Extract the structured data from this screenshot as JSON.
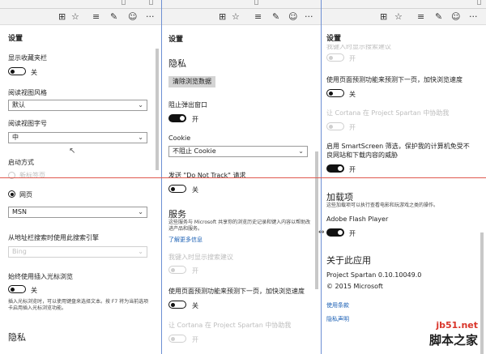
{
  "colors": {
    "accent_line": "#6d8fd3",
    "red_line": "#e05a4f",
    "link": "#1a5fb4",
    "toggle_on": "#111111"
  },
  "icons": [
    "reading-view-icon",
    "favorites-star-icon",
    "hub-icon",
    "web-note-icon",
    "smiley-feedback-icon",
    "more-icon"
  ],
  "panel1": {
    "header": "设置",
    "show_favorites_bar": {
      "label": "显示收藏夹栏",
      "state": "关"
    },
    "reading_style": {
      "label": "阅读视图风格",
      "value": "默认"
    },
    "reading_font": {
      "label": "阅读视图字号",
      "value": "中"
    },
    "startup": {
      "label": "启动方式",
      "option_disabled": "新标签页",
      "option_selected": "网页",
      "selected_value": "MSN"
    },
    "search_engine": {
      "label": "从地址栏搜索时使用此搜索引擎",
      "value": "Bing"
    },
    "caret_browsing": {
      "label": "始终使用插入光标浏览",
      "state": "关",
      "desc": "插入光标浏览时，可以使用键盘来选择文本。按 F7 将为当前选项卡启用插入光标浏览功能。"
    },
    "privacy_heading": "隐私"
  },
  "panel2": {
    "header": "设置",
    "privacy_heading": "隐私",
    "clear_button": "清除浏览数据",
    "block_popups": {
      "label": "阻止弹出窗口",
      "state": "开"
    },
    "cookie": {
      "label": "Cookie",
      "value": "不阻止 Cookie"
    },
    "dnt": {
      "label": "发送 \"Do Not Track\" 请求",
      "state": "关"
    },
    "services_heading": "服务",
    "services_desc": "这些服务与 Microsoft 共享你的浏览历史记录和键入内容以帮助改进产品和服务。",
    "learn_more": "了解更多信息",
    "search_suggestions": {
      "label": "我键入时显示搜索建议",
      "state": "开"
    },
    "page_prediction": {
      "label": "使用页面预测功能来预测下一页，加快浏览速度",
      "state": "关"
    },
    "cortana": {
      "label": "让 Cortana 在 Project Spartan 中协助我",
      "state": "开"
    }
  },
  "panel3": {
    "header": "设置",
    "top_cut_label": "我键入时显示搜索建议",
    "top_state": "开",
    "page_prediction": {
      "label": "使用页面预测功能来预测下一页，加快浏览速度",
      "state": "关"
    },
    "cortana": {
      "label": "让 Cortana 在 Project Spartan 中协助我",
      "state": "开"
    },
    "smartscreen": {
      "label": "启用 SmartScreen 筛选，保护我的计算机免受不良网站和下载内容的威胁",
      "state": "开"
    },
    "addons_heading": "加载项",
    "addons_desc": "这些加载项可以执行查看电影和玩游戏之类的操作。",
    "flash": {
      "label": "Adobe Flash Player",
      "state": "开"
    },
    "about_heading": "关于此应用",
    "app_name": "Project Spartan 0.10.10049.0",
    "copyright": "© 2015 Microsoft",
    "terms": "使用条款",
    "privacy": "隐私声明"
  },
  "watermark": {
    "site": "jb51.net",
    "name": "脚本之家"
  }
}
